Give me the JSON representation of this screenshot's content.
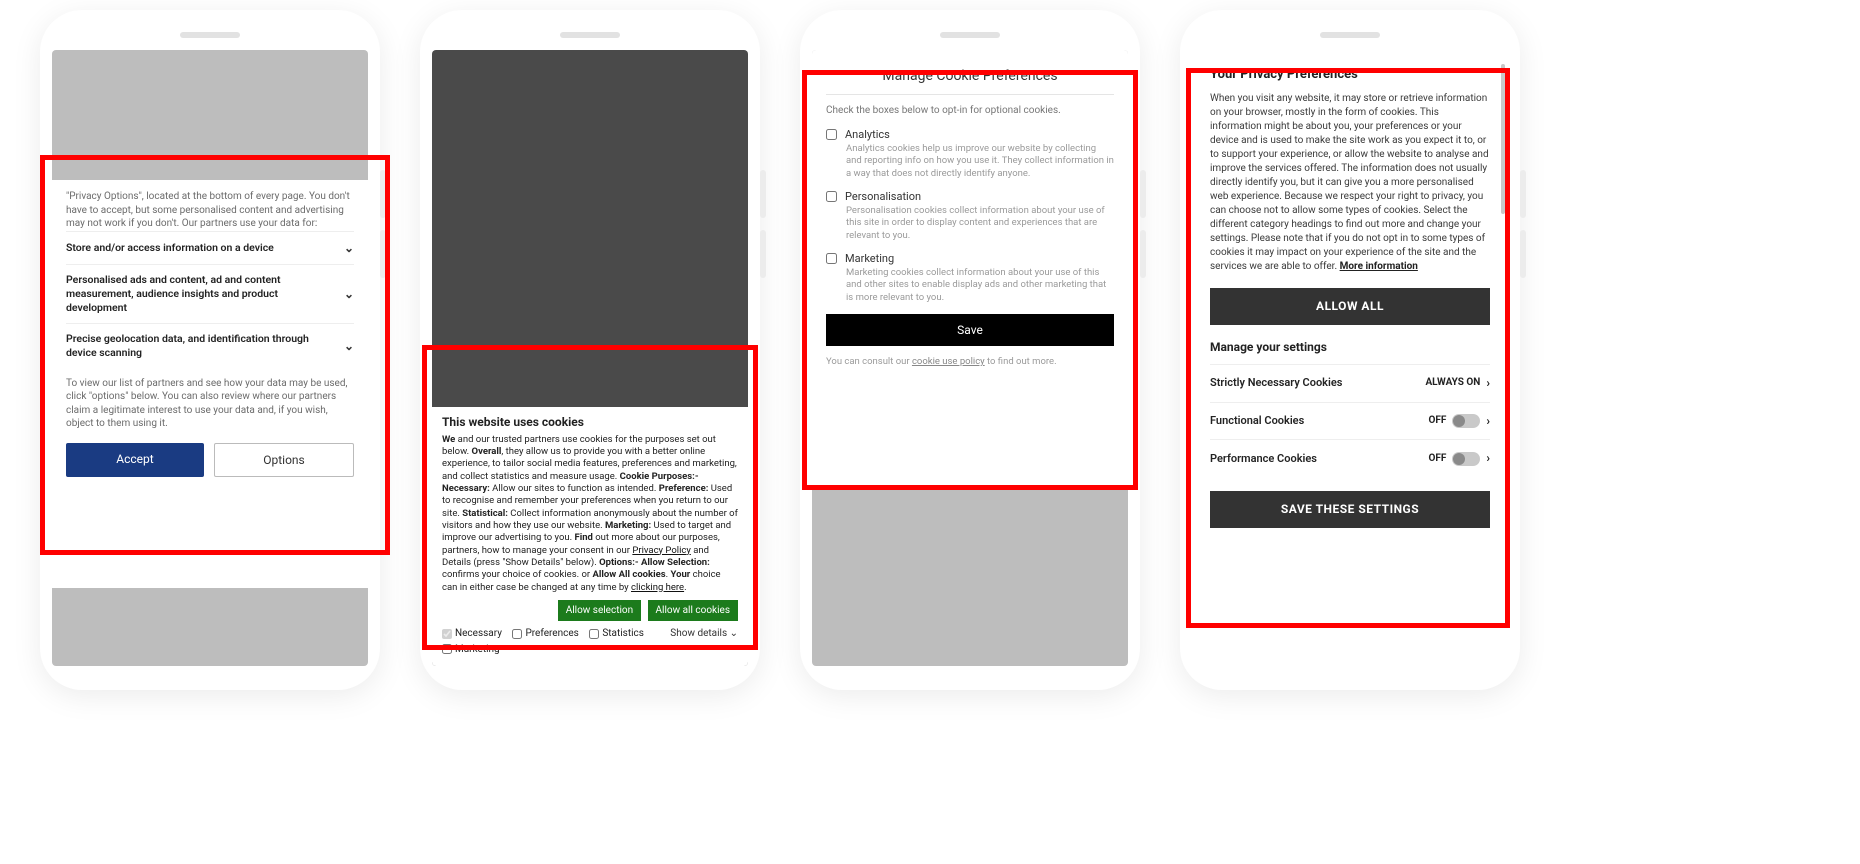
{
  "phone1": {
    "intro": "\"Privacy Options\", located at the bottom of every page. You don't have to accept, but some personalised content and advertising may not work if you don't. Our partners use your data for:",
    "rows": [
      "Store and/or access information on a device",
      "Personalised ads and content, ad and content measurement, audience insights and product development",
      "Precise geolocation data, and identification through device scanning"
    ],
    "footer": "To view our list of partners and see how your data may be used, click \"options\" below. You can also review where our partners claim a legitimate interest to use your data and, if you wish, object to them using it.",
    "accept": "Accept",
    "options": "Options"
  },
  "phone2": {
    "title": "This website uses cookies",
    "body_parts": {
      "p1a": "We",
      "p1b": " and our trusted partners use cookies for the purposes set out below. ",
      "p2a": "Overall",
      "p2b": ", they allow us to provide you with a better online experience, to tailor social media features, preferences and marketing, and collect statistics and measure usage. ",
      "p3a": "Cookie Purposes:- Necessary:",
      "p3b": " Allow our sites to function as intended. ",
      "p4a": "Preference:",
      "p4b": " Used to recognise and remember your preferences when you return to our site. ",
      "p5a": "Statistical:",
      "p5b": " Collect information anonymously about the number of visitors and how they use our website. ",
      "p6a": "Marketing:",
      "p6b": " Used to target and improve our advertising to you. ",
      "p7a": "Find",
      "p7b": " out more about our purposes, partners, how to manage your consent in our ",
      "p7link": "Privacy Policy",
      "p8": " and Details (press \"Show Details\" below). ",
      "p9a": "Options:- Allow Selection:",
      "p9b": " confirms your choice of cookies. or ",
      "p10a": "Allow All cookies",
      "p10b": ". ",
      "p11a": "Your",
      "p11b": " choice can in either case be changed at any time by ",
      "p11link": "clicking here",
      "p11end": "."
    },
    "allow_selection": "Allow selection",
    "allow_all": "Allow all cookies",
    "checks": {
      "necessary": "Necessary",
      "preferences": "Preferences",
      "statistics": "Statistics",
      "marketing": "Marketing"
    },
    "show_details": "Show details"
  },
  "phone3": {
    "title": "Manage Cookie Preferences",
    "intro": "Check the boxes below to opt-in for optional cookies.",
    "cats": [
      {
        "name": "Analytics",
        "desc": "Analytics cookies help us improve our website by collecting and reporting info on how you use it. They collect information in a way that does not directly identify anyone."
      },
      {
        "name": "Personalisation",
        "desc": "Personalisation cookies collect information about your use of this site in order to display content and experiences that are relevant to you."
      },
      {
        "name": "Marketing",
        "desc": "Marketing cookies collect information about your use of this and other sites to enable display ads and other marketing that is more relevant to you."
      }
    ],
    "save": "Save",
    "foot_a": "You can consult our ",
    "foot_link": "cookie use policy",
    "foot_b": " to find out more."
  },
  "phone4": {
    "title": "Your Privacy Preferences",
    "body": "When you visit any website, it may store or retrieve information on your browser, mostly in the form of cookies. This information might be about you, your preferences or your device and is used to make the site work as you expect it to, or to support your experience, or allow the website to analyse and improve the services offered. The information does not usually directly identify you, but it can give you a more personalised web experience. Because we respect your right to privacy, you can choose not to allow some types of cookies. Select the different category headings to find out more and change your settings. Please note that if you do not opt in to some types of cookies it may impact on your experience of the site and the services we are able to offer.  ",
    "more": "More information",
    "allow_all": "ALLOW ALL",
    "manage": "Manage your settings",
    "settings": [
      {
        "name": "Strictly Necessary Cookies",
        "state": "ALWAYS ON",
        "toggle": false
      },
      {
        "name": "Functional Cookies",
        "state": "OFF",
        "toggle": true
      },
      {
        "name": "Performance Cookies",
        "state": "OFF",
        "toggle": true
      }
    ],
    "save": "SAVE THESE SETTINGS"
  }
}
